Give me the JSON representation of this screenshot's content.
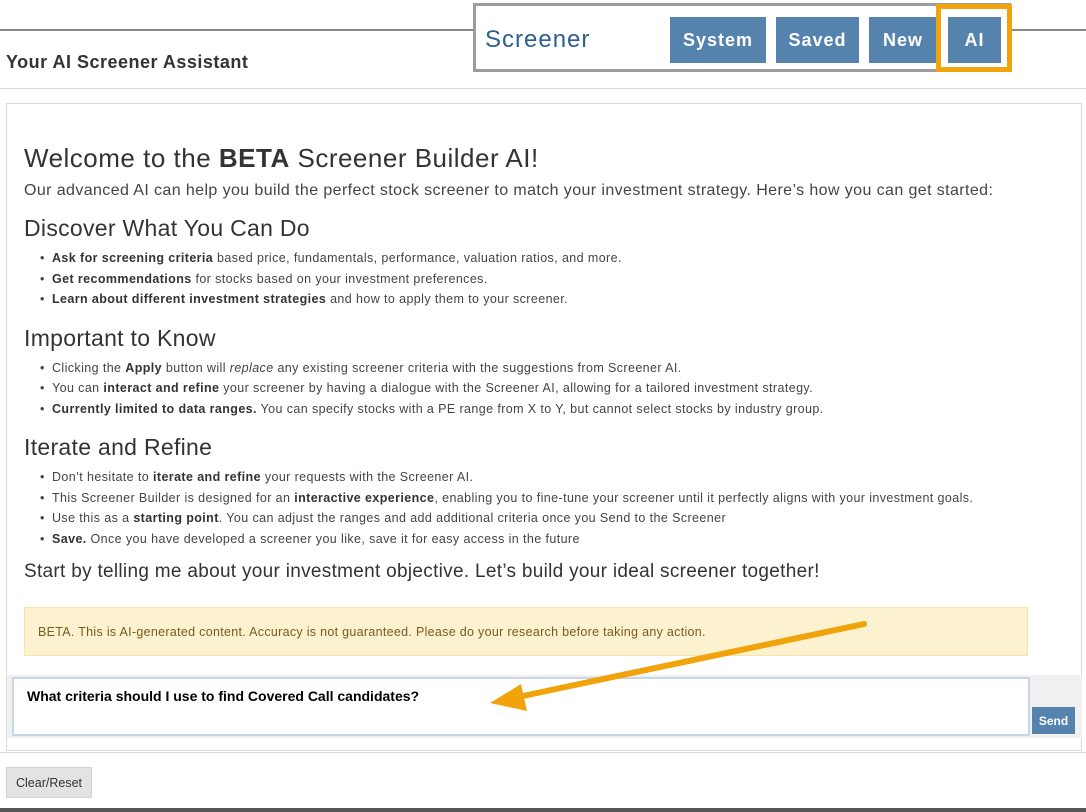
{
  "header": {
    "title": "Your AI Screener Assistant"
  },
  "toolbar": {
    "title": "Screener",
    "buttons": {
      "system": "System",
      "saved": "Saved",
      "new": "New",
      "ai": "AI"
    }
  },
  "welcome": {
    "title_prefix": "Welcome to the ",
    "title_bold": "BETA",
    "title_suffix": " Screener Builder AI!",
    "intro": "Our advanced AI can help you build the perfect stock screener to match your investment strategy. Here’s how you can get started:"
  },
  "discover": {
    "heading": "Discover What You Can Do",
    "items": [
      {
        "bold": "Ask for screening criteria",
        "text": " based price, fundamentals, performance, valuation ratios, and more."
      },
      {
        "bold": "Get recommendations",
        "text": " for stocks based on your investment preferences."
      },
      {
        "bold": "Learn about different investment strategies",
        "text": " and how to apply them to your screener."
      }
    ]
  },
  "important": {
    "heading": "Important to Know",
    "item1": {
      "pre": "Clicking the ",
      "bold": "Apply",
      "mid": " button will ",
      "em": "replace",
      "post": " any existing screener criteria with the suggestions from Screener AI."
    },
    "item2": {
      "pre": "You can ",
      "bold": "interact and refine",
      "post": " your screener by having a dialogue with the Screener AI, allowing for a tailored investment strategy."
    },
    "item3": {
      "bold": "Currently limited to data ranges.",
      "post": " You can specify stocks with a PE range from X to Y, but cannot select stocks by industry group."
    }
  },
  "iterate": {
    "heading": "Iterate and Refine",
    "item1": {
      "pre": "Don’t hesitate to ",
      "bold": "iterate and refine",
      "post": " your requests with the Screener AI."
    },
    "item2": {
      "pre": "This Screener Builder is designed for an ",
      "bold": "interactive experience",
      "post": ", enabling you to fine-tune your screener until it perfectly aligns with your investment goals."
    },
    "item3": {
      "pre": "Use this as a ",
      "bold": "starting point",
      "post": ". You can adjust the ranges and add additional criteria once you Send to the Screener"
    },
    "item4": {
      "bold": "Save.",
      "post": " Once you have developed a screener you like, save it for easy access in the future"
    }
  },
  "closing": "Start by telling me about your investment objective. Let’s build your ideal screener together!",
  "beta_notice": "BETA. This is AI-generated content. Accuracy is not guaranteed. Please do your research before taking any action.",
  "chat": {
    "input_value": "What criteria should I use to find Covered Call candidates?",
    "send_label": "Send"
  },
  "footer": {
    "clear_label": "Clear/Reset"
  },
  "colors": {
    "accent": "#5683ad",
    "highlight": "#f0a30a",
    "notice_bg": "#fcf2cf"
  }
}
